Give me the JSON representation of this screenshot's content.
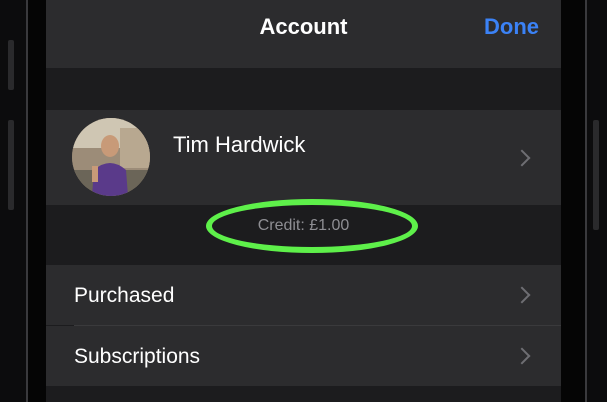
{
  "nav": {
    "title": "Account",
    "done_label": "Done"
  },
  "profile": {
    "name": "Tim Hardwick",
    "avatar_icon": "person-photo"
  },
  "credit": {
    "text": "Credit: £1.00",
    "highlight_color": "#5ef04a"
  },
  "menu": {
    "items": [
      {
        "label": "Purchased"
      },
      {
        "label": "Subscriptions"
      }
    ]
  },
  "colors": {
    "accent": "#3b82f6",
    "background": "#1c1c1e",
    "row": "#2c2c2e"
  }
}
